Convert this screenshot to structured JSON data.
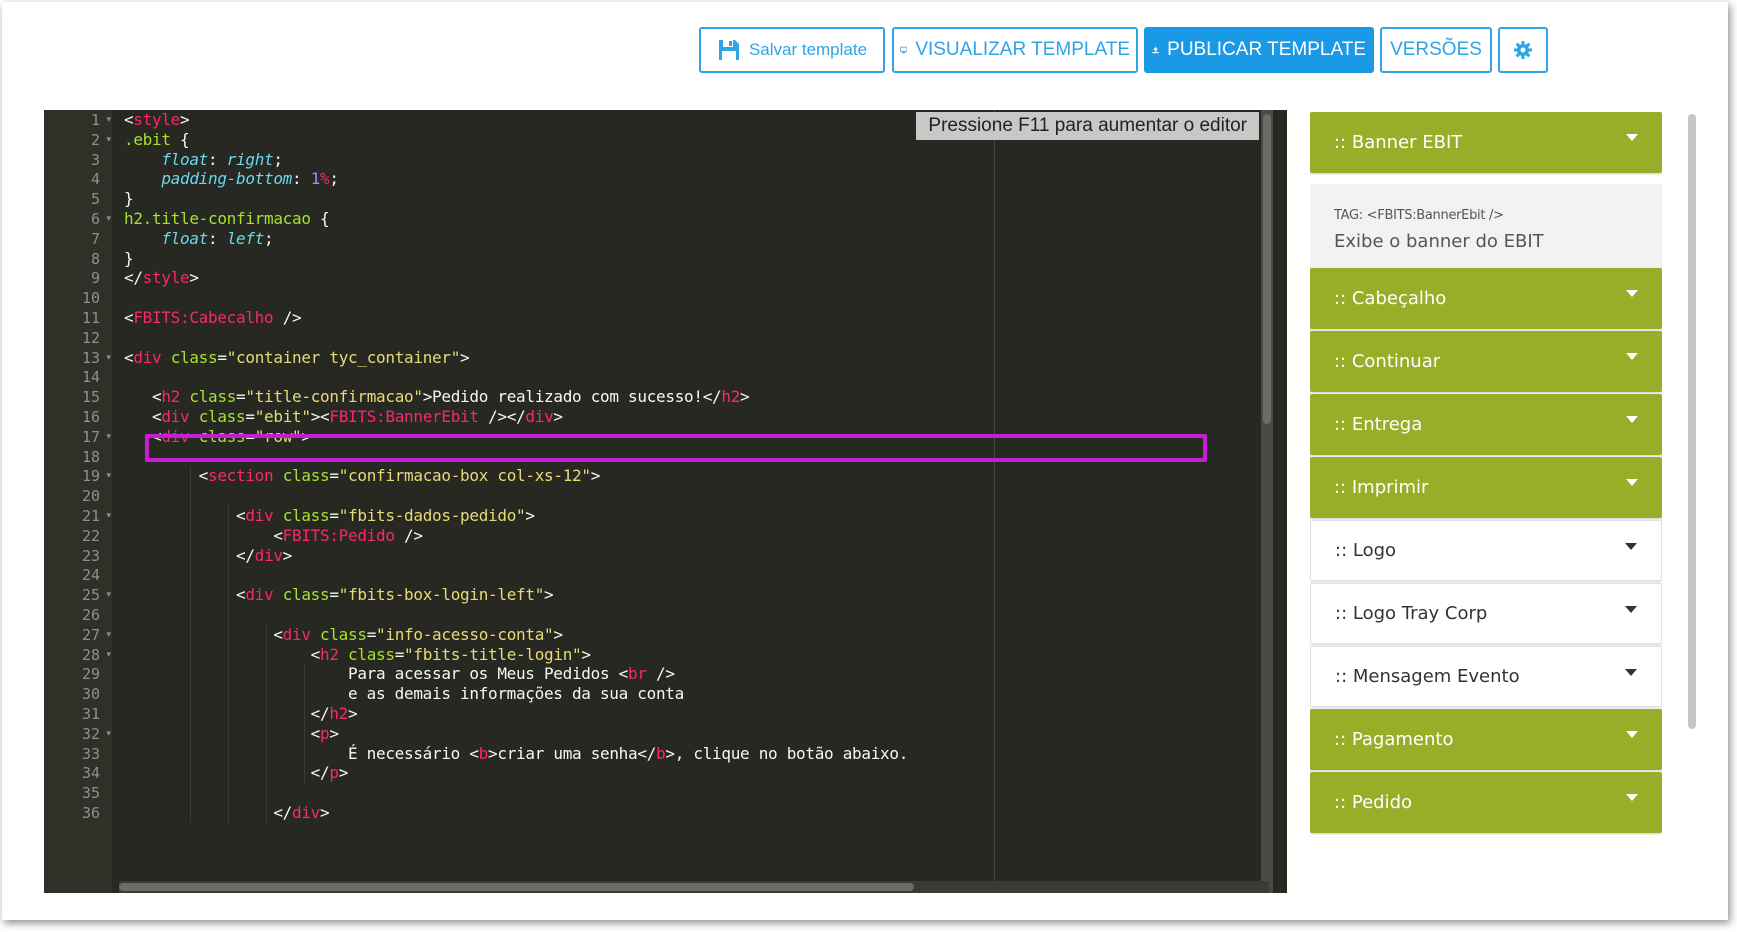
{
  "toolbar": {
    "save_label": "Salvar template",
    "preview_label": "VISUALIZAR TEMPLATE",
    "publish_label": "PUBLICAR TEMPLATE",
    "versions_label": "VERSÕES"
  },
  "editor": {
    "hint": "Pressione F11 para aumentar o editor",
    "line_numbers": [
      "1",
      "2",
      "3",
      "4",
      "5",
      "6",
      "7",
      "8",
      "9",
      "10",
      "11",
      "12",
      "13",
      "14",
      "15",
      "16",
      "17",
      "18",
      "19",
      "20",
      "21",
      "22",
      "23",
      "24",
      "25",
      "26",
      "27",
      "28",
      "29",
      "30",
      "31",
      "32",
      "33",
      "34",
      "35",
      "36"
    ],
    "lines": [
      "<style>",
      ".ebit {",
      "    float: right;",
      "    padding-bottom: 1%;",
      "}",
      "h2.title-confirmacao {",
      "    float: left;",
      "}",
      "</style>",
      "",
      "<FBITS:Cabecalho />",
      "",
      "<div class=\"container tyc_container\">",
      "",
      "   <h2 class=\"title-confirmacao\">Pedido realizado com sucesso!</h2>",
      "   <div class=\"ebit\"><FBITS:BannerEbit /></div>",
      "   <div class=\"row\">",
      "",
      "        <section class=\"confirmacao-box col-xs-12\">",
      "",
      "            <div class=\"fbits-dados-pedido\">",
      "                <FBITS:Pedido />",
      "            </div>",
      "",
      "            <div class=\"fbits-box-login-left\">",
      "",
      "                <div class=\"info-acesso-conta\">",
      "                    <h2 class=\"fbits-title-login\">",
      "                        Para acessar os Meus Pedidos <br />",
      "                        e as demais informações da sua conta",
      "                    </h2>",
      "                    <p>",
      "                        É necessário <b>criar uma senha</b>, clique no botão abaixo.",
      "                    </p>",
      "",
      "                </div>"
    ]
  },
  "panel": {
    "sections": [
      {
        "label": ":: Banner EBIT",
        "expanded": true,
        "tag": "TAG: <FBITS:BannerEbit />",
        "description": "Exibe o banner do EBIT"
      },
      {
        "label": ":: Cabeçalho"
      },
      {
        "label": ":: Continuar"
      },
      {
        "label": ":: Entrega"
      },
      {
        "label": ":: Imprimir"
      },
      {
        "label": ":: Logo"
      },
      {
        "label": ":: Logo Tray Corp"
      },
      {
        "label": ":: Mensagem Evento"
      },
      {
        "label": ":: Pagamento"
      },
      {
        "label": ":: Pedido"
      }
    ]
  },
  "colors": {
    "accent": "#1a9ae6",
    "section_green": "#9aad29",
    "highlight": "#c21fd4",
    "editor_bg": "#272822"
  }
}
